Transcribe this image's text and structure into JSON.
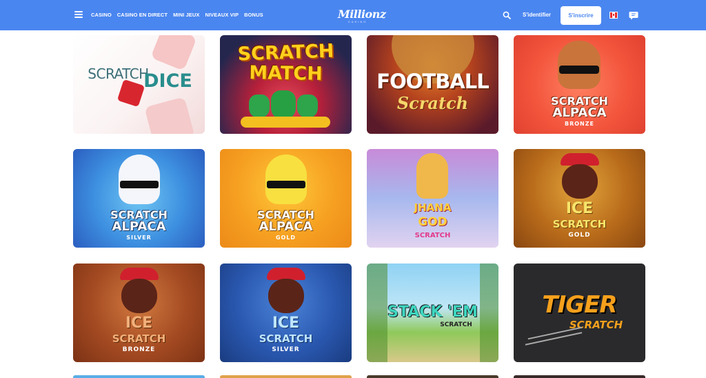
{
  "header": {
    "brand": "Millionz",
    "brand_sub": "CASINO",
    "nav": [
      "CASINO",
      "CASINO EN DIRECT",
      "MINI JEUX",
      "NIVEAUX VIP",
      "BONUS"
    ],
    "login_label": "S'identifier",
    "signup_label": "S'inscrire",
    "accent_color": "#4a86f0"
  },
  "games": [
    {
      "l1": "SCRATCH",
      "l2": "DICE",
      "l3": ""
    },
    {
      "l1": "SCRATCH",
      "l2": "MATCH",
      "l3": ""
    },
    {
      "l1": "FOOTBALL",
      "l2": "Scratch",
      "l3": ""
    },
    {
      "l1": "SCRATCH",
      "l2": "ALPACA",
      "l3": "BRONZE"
    },
    {
      "l1": "SCRATCH",
      "l2": "ALPACA",
      "l3": "SILVER"
    },
    {
      "l1": "SCRATCH",
      "l2": "ALPACA",
      "l3": "GOLD"
    },
    {
      "l1": "JHANA",
      "l2": "GOD",
      "l3": "SCRATCH"
    },
    {
      "l1": "ICE",
      "l2": "SCRATCH",
      "l3": "GOLD"
    },
    {
      "l1": "ICE",
      "l2": "SCRATCH",
      "l3": "BRONZE"
    },
    {
      "l1": "ICE",
      "l2": "SCRATCH",
      "l3": "SILVER"
    },
    {
      "l1": "STACK 'EM",
      "l2": "SCRATCH",
      "l3": ""
    },
    {
      "l1": "TIGER",
      "l2": "SCRATCH",
      "l3": ""
    }
  ]
}
